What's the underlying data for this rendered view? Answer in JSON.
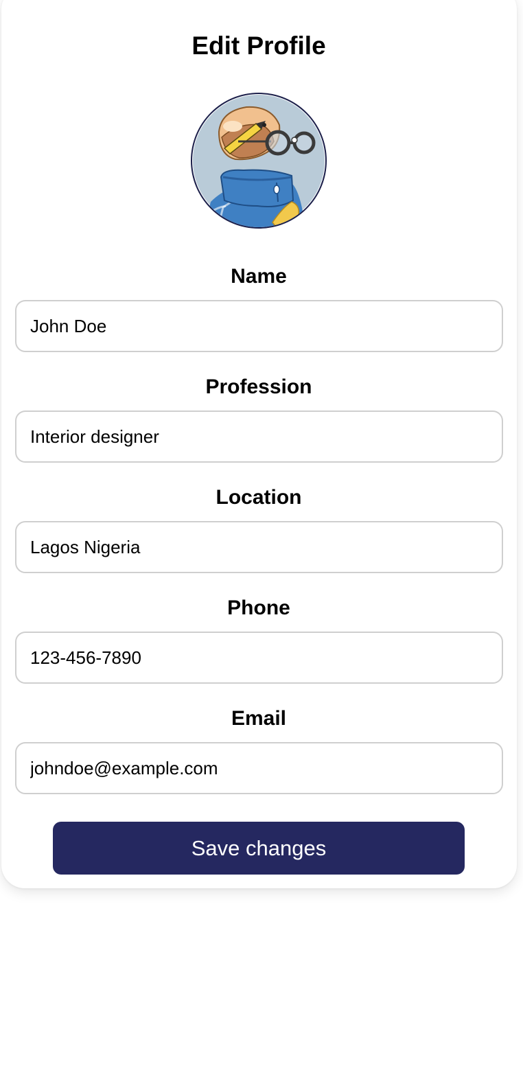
{
  "page": {
    "title": "Edit Profile"
  },
  "avatar": {
    "icon": "avatar-illustration-person-with-glasses",
    "colors": {
      "background": "#b9cbd8",
      "skin": "#f1c08e",
      "jacket": "#3f80c3"
    }
  },
  "form": {
    "fields": [
      {
        "label": "Name",
        "value": "John Doe"
      },
      {
        "label": "Profession",
        "value": "Interior designer"
      },
      {
        "label": "Location",
        "value": "Lagos Nigeria"
      },
      {
        "label": "Phone",
        "value": "123-456-7890"
      },
      {
        "label": "Email",
        "value": "johndoe@example.com"
      }
    ]
  },
  "actions": {
    "save_label": "Save changes"
  },
  "colors": {
    "button_background": "#252860",
    "button_text": "#ffffff",
    "input_border": "#cfcfcf"
  }
}
